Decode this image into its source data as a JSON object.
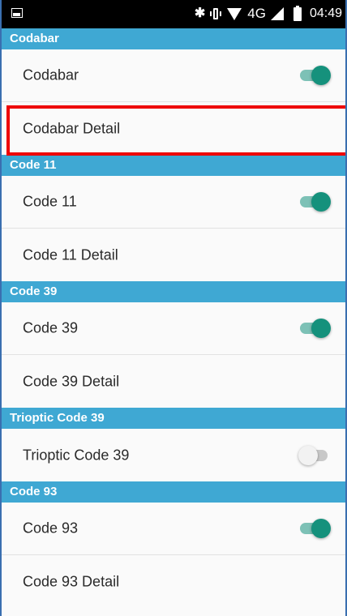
{
  "status_bar": {
    "icons": [
      "image-icon",
      "bluetooth-icon",
      "vibrate-icon",
      "wifi-icon",
      "signal-icon",
      "battery-icon"
    ],
    "network": "4G",
    "time": "04:49"
  },
  "sections": [
    {
      "header": "Codabar",
      "rows": [
        {
          "label": "Codabar",
          "toggle": "on"
        },
        {
          "label": "Codabar Detail",
          "highlighted": true
        }
      ]
    },
    {
      "header": "Code 11",
      "rows": [
        {
          "label": "Code 11",
          "toggle": "on"
        },
        {
          "label": "Code 11 Detail"
        }
      ]
    },
    {
      "header": "Code 39",
      "rows": [
        {
          "label": "Code 39",
          "toggle": "on"
        },
        {
          "label": "Code 39 Detail"
        }
      ]
    },
    {
      "header": "Trioptic Code 39",
      "rows": [
        {
          "label": "Trioptic Code 39",
          "toggle": "off"
        }
      ]
    },
    {
      "header": "Code 93",
      "rows": [
        {
          "label": "Code 93",
          "toggle": "on"
        },
        {
          "label": "Code 93 Detail"
        }
      ]
    }
  ],
  "colors": {
    "section_header_bg": "#3fa8d3",
    "toggle_on": "#15917c",
    "toggle_off": "#f2f2f2",
    "highlight": "#ee0000"
  }
}
